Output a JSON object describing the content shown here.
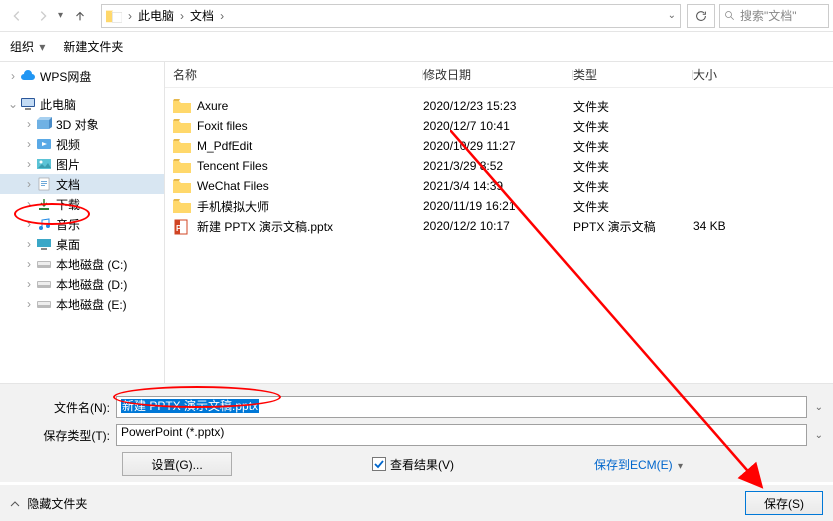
{
  "address": {
    "crumb1": "此电脑",
    "crumb2": "文档"
  },
  "search": {
    "placeholder": "搜索\"文档\""
  },
  "toolbar": {
    "organize": "组织",
    "newfolder": "新建文件夹"
  },
  "sidebar": {
    "wps": "WPS网盘",
    "pc": "此电脑",
    "items": [
      {
        "label": "3D 对象"
      },
      {
        "label": "视频"
      },
      {
        "label": "图片"
      },
      {
        "label": "文档"
      },
      {
        "label": "下载"
      },
      {
        "label": "音乐"
      },
      {
        "label": "桌面"
      },
      {
        "label": "本地磁盘 (C:)"
      },
      {
        "label": "本地磁盘 (D:)"
      },
      {
        "label": "本地磁盘 (E:)"
      }
    ]
  },
  "columns": {
    "name": "名称",
    "date": "修改日期",
    "type": "类型",
    "size": "大小"
  },
  "files": [
    {
      "name": "Axure",
      "date": "2020/12/23 15:23",
      "type": "文件夹",
      "size": "",
      "kind": "folder"
    },
    {
      "name": "Foxit files",
      "date": "2020/12/7 10:41",
      "type": "文件夹",
      "size": "",
      "kind": "folder"
    },
    {
      "name": "M_PdfEdit",
      "date": "2020/10/29 11:27",
      "type": "文件夹",
      "size": "",
      "kind": "folder"
    },
    {
      "name": "Tencent Files",
      "date": "2021/3/29 8:52",
      "type": "文件夹",
      "size": "",
      "kind": "folder"
    },
    {
      "name": "WeChat Files",
      "date": "2021/3/4 14:39",
      "type": "文件夹",
      "size": "",
      "kind": "folder"
    },
    {
      "name": "手机模拟大师",
      "date": "2020/11/19 16:21",
      "type": "文件夹",
      "size": "",
      "kind": "folder"
    },
    {
      "name": "新建 PPTX 演示文稿.pptx",
      "date": "2020/12/2 10:17",
      "type": "PPTX 演示文稿",
      "size": "34 KB",
      "kind": "pptx"
    }
  ],
  "form": {
    "filename_label": "文件名(N):",
    "filename_value": "新建 PPTX 演示文稿.pptx",
    "savetype_label": "保存类型(T):",
    "savetype_value": "PowerPoint (*.pptx)",
    "settings_btn": "设置(G)...",
    "view_result": "查看结果(V)",
    "ecm_link": "保存到ECM(E)",
    "hide_folders": "隐藏文件夹",
    "save_btn": "保存(S)"
  }
}
